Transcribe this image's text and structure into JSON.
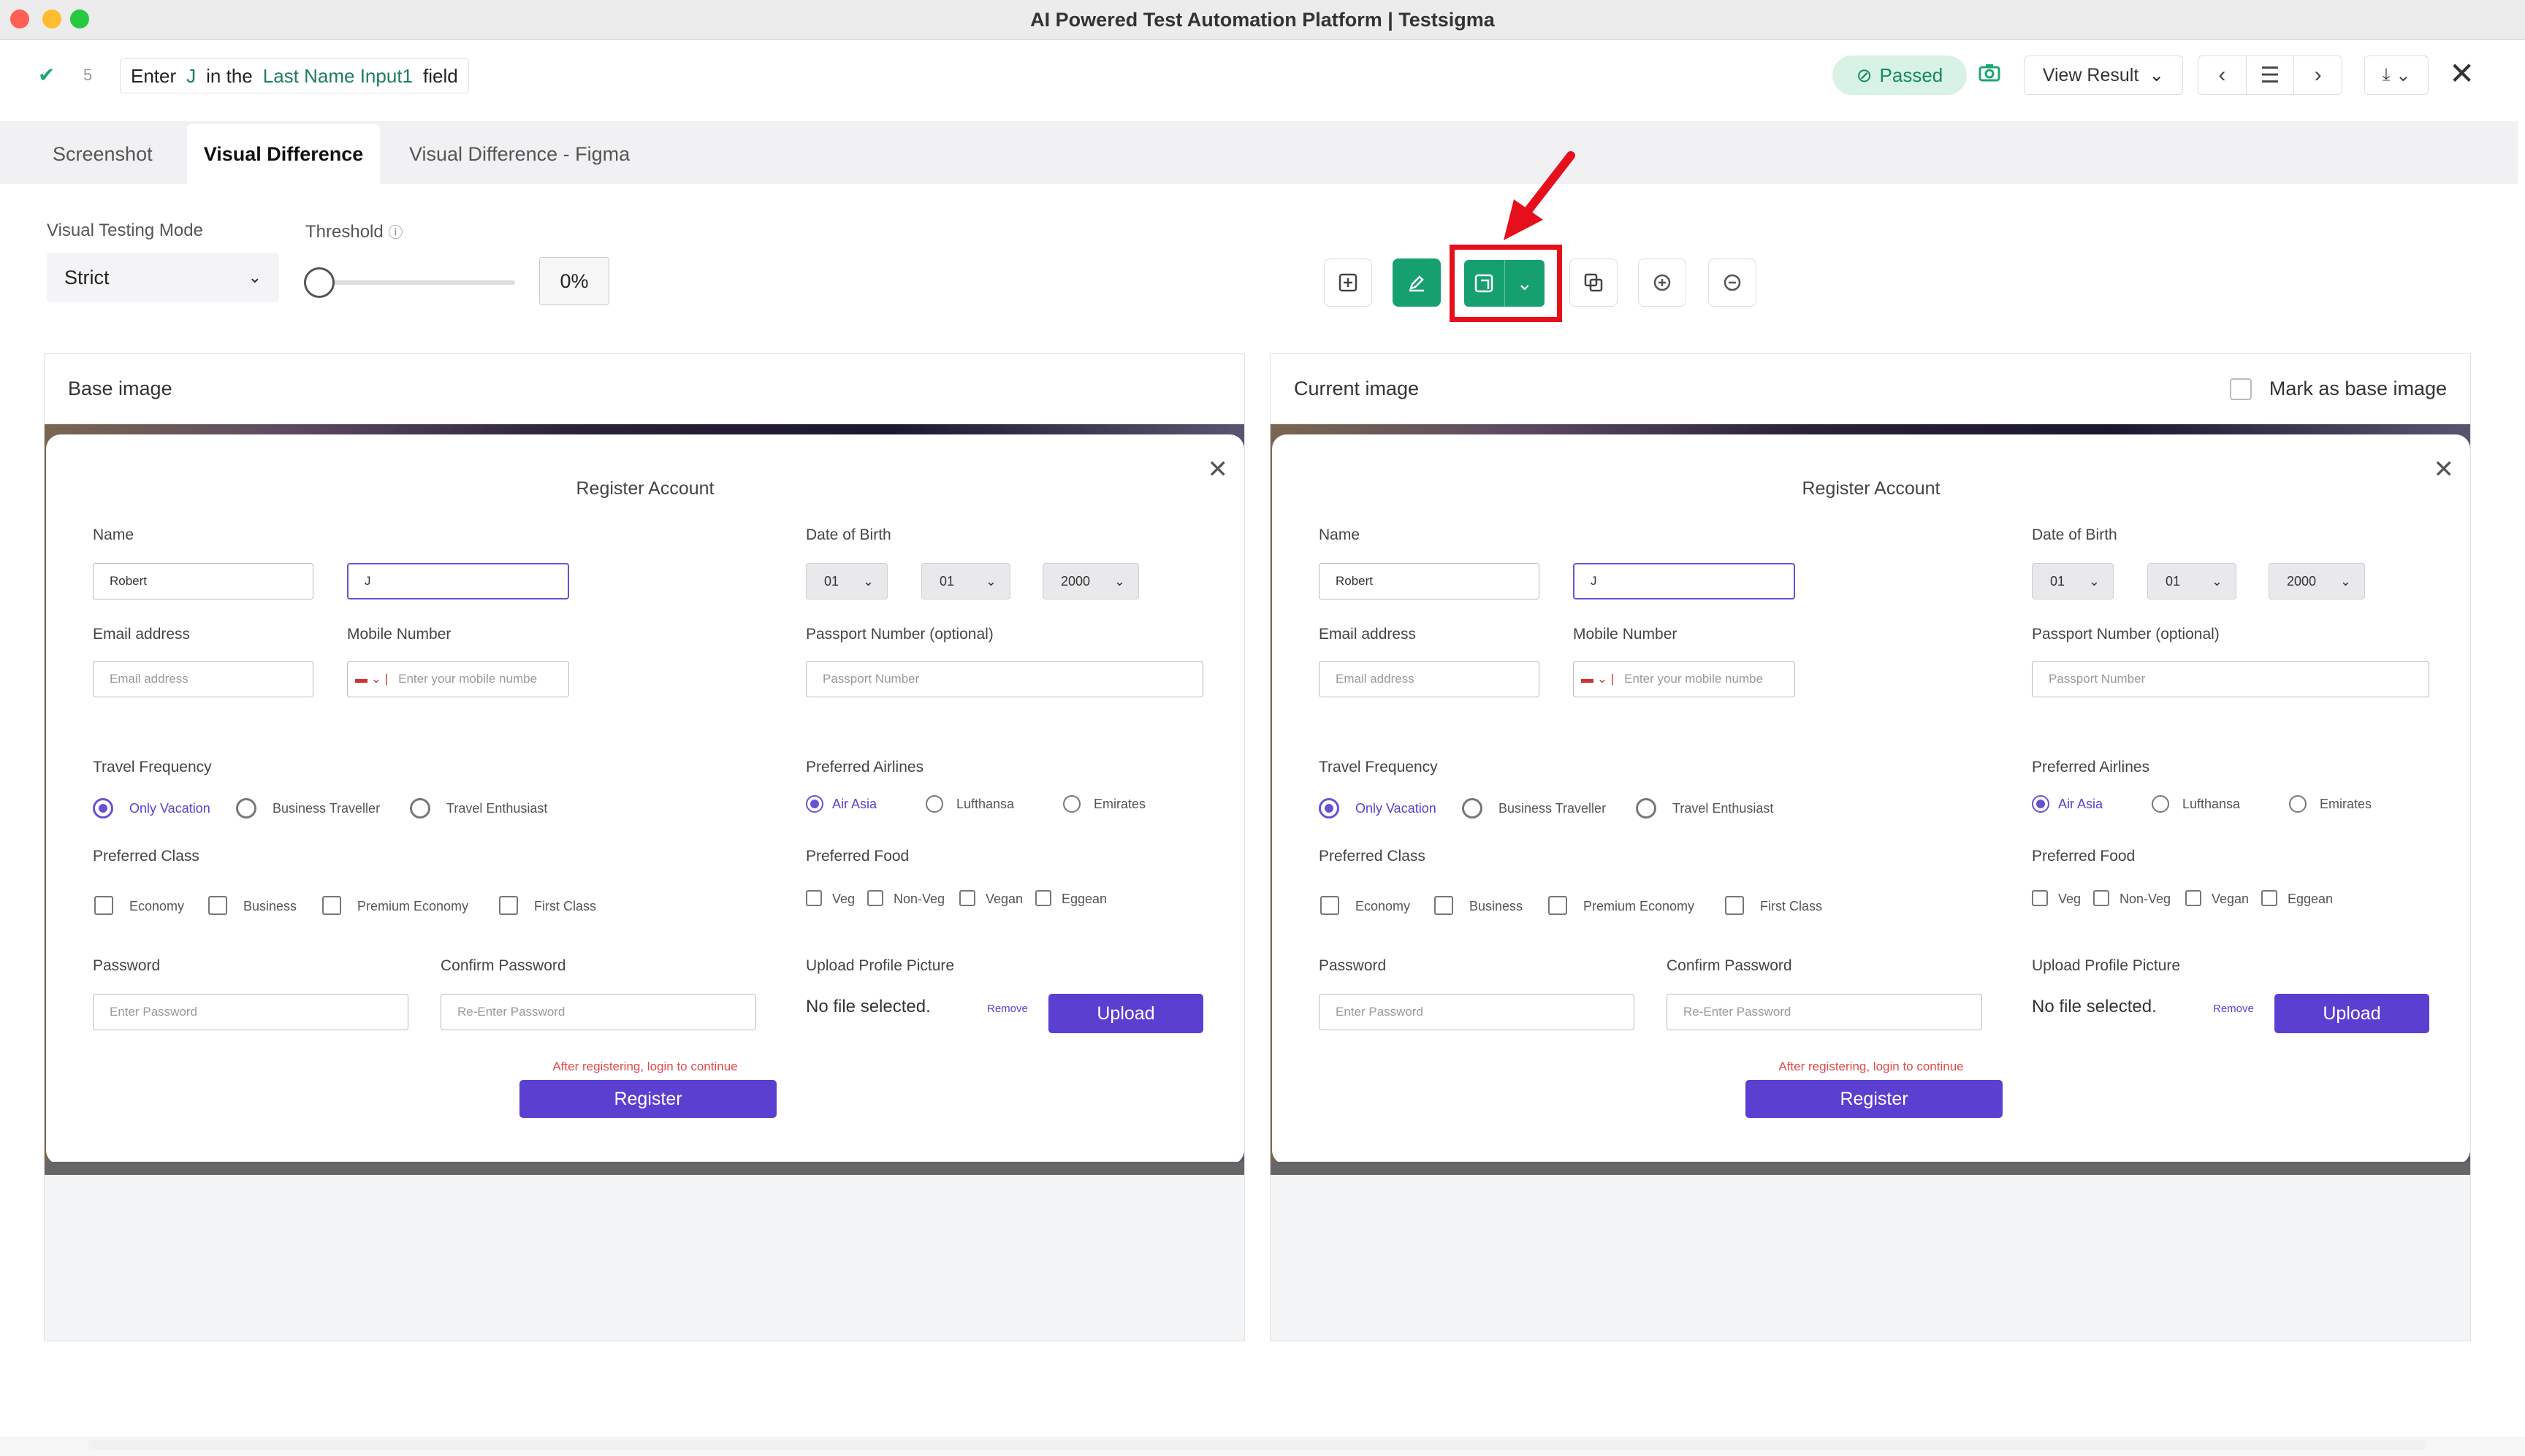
{
  "window": {
    "title": "AI Powered Test Automation Platform | Testsigma"
  },
  "step": {
    "number": "5",
    "parts": [
      "Enter",
      "J",
      "in the",
      "Last Name Input1",
      "field"
    ],
    "status": "Passed",
    "view_result": "View Result"
  },
  "tabs": [
    "Screenshot",
    "Visual Difference",
    "Visual Difference - Figma"
  ],
  "controls": {
    "mode_label": "Visual Testing Mode",
    "mode_value": "Strict",
    "threshold_label": "Threshold",
    "threshold_value": "0%"
  },
  "panels": {
    "base_title": "Base image",
    "current_title": "Current image",
    "mark_as_base": "Mark as base image"
  },
  "form": {
    "title": "Register Account",
    "name_label": "Name",
    "first_name": "Robert",
    "last_name": "J",
    "dob_label": "Date of Birth",
    "dob_day": "01",
    "dob_month": "01",
    "dob_year": "2000",
    "email_label": "Email address",
    "email_placeholder": "Email address",
    "mobile_label": "Mobile Number",
    "mobile_placeholder": "Enter your mobile numbe",
    "passport_label": "Passport Number (optional)",
    "passport_placeholder": "Passport Number",
    "travel_label": "Travel Frequency",
    "travel_options": [
      "Only Vacation",
      "Business Traveller",
      "Travel Enthusiast"
    ],
    "airlines_label": "Preferred Airlines",
    "airline_options": [
      "Air Asia",
      "Lufthansa",
      "Emirates"
    ],
    "class_label": "Preferred Class",
    "class_options": [
      "Economy",
      "Business",
      "Premium Economy",
      "First Class"
    ],
    "food_label": "Preferred Food",
    "food_options": [
      "Veg",
      "Non-Veg",
      "Vegan",
      "Eggean"
    ],
    "password_label": "Password",
    "password_placeholder": "Enter Password",
    "confirm_label": "Confirm Password",
    "confirm_placeholder": "Re-Enter Password",
    "upload_label": "Upload Profile Picture",
    "no_file": "No file selected.",
    "remove": "Remove",
    "upload_btn": "Upload",
    "login_note": "After registering, login to continue",
    "register_btn": "Register"
  }
}
